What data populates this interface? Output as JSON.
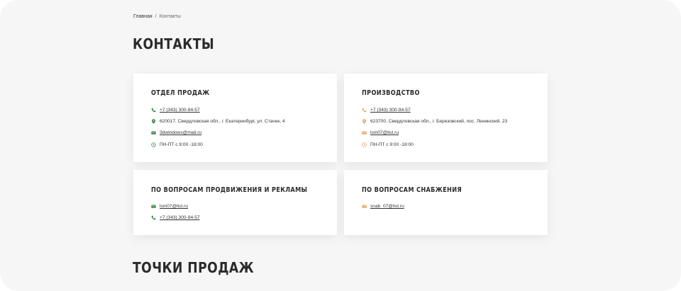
{
  "breadcrumb": {
    "home": "Главная",
    "separator": "/",
    "current": "Контакты"
  },
  "page_title": "КОНТАКТЫ",
  "section2_title": "ТОЧКИ ПРОДАЖ",
  "colors": {
    "green": "#2f7d3a",
    "orange": "#e8a25a",
    "background": "#f6f6f6"
  },
  "cards": [
    {
      "title": "ОТДЕЛ ПРОДАЖ",
      "icon_color": "green",
      "phone": "+7 (343) 300-94-57",
      "address": "620017, Свердловская обл., г. Екатеринбург, ул. Стачек, 4",
      "email": "3dwindows@mail.ru",
      "hours": "ПН-ПТ с 9:00 -18:00"
    },
    {
      "title": "ПРОИЗВОДСТВО",
      "icon_color": "orange",
      "phone": "+7 (343) 300-94-57",
      "address": "623700, Свердловская обл., г. Березовский, пос. Ленинский, 23",
      "email": "lsm07@list.ru",
      "hours": "ПН-ПТ с 9:00 -18:00"
    },
    {
      "title": "ПО ВОПРОСАМ ПРОДВИЖЕНИЯ И РЕКЛАМЫ",
      "icon_color": "green",
      "email": "lsm07@list.ru",
      "phone": "+7 (343) 300-94-57"
    },
    {
      "title": "ПО ВОПРОСАМ СНАБЖЕНИЯ",
      "icon_color": "orange",
      "email": "snab_07@list.ru"
    }
  ]
}
